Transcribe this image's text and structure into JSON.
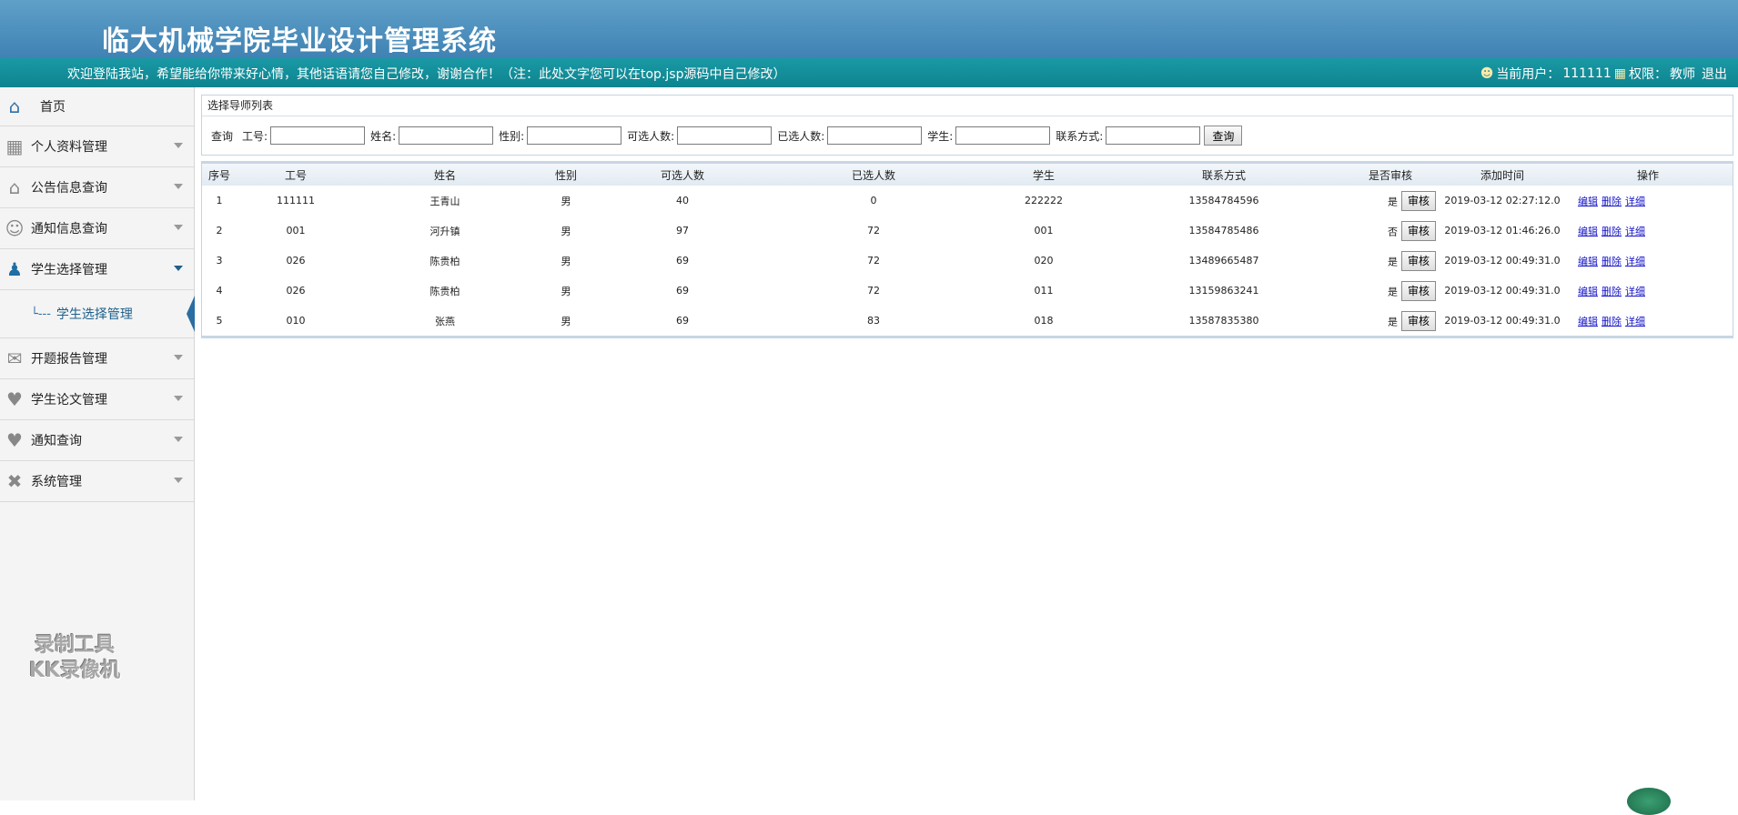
{
  "header": {
    "title": "临大机械学院毕业设计管理系统",
    "welcome": "欢迎登陆我站，希望能给你带来好心情，其他话语请您自己修改，谢谢合作！（注：此处文字您可以在top.jsp源码中自己修改）",
    "current_user_label": "当前用户：",
    "current_user": "111111",
    "role_label": "权限：",
    "role": "教师",
    "logout": "退出"
  },
  "sidebar": {
    "items": [
      {
        "label": "首页",
        "icon": "home-icon"
      },
      {
        "label": "个人资料管理",
        "icon": "grid-icon"
      },
      {
        "label": "公告信息查询",
        "icon": "house-icon"
      },
      {
        "label": "通知信息查询",
        "icon": "users-icon"
      },
      {
        "label": "学生选择管理",
        "icon": "user-icon"
      },
      {
        "label": "开题报告管理",
        "icon": "chat-icon"
      },
      {
        "label": "学生论文管理",
        "icon": "heart-icon"
      },
      {
        "label": "通知查询",
        "icon": "heart-icon"
      },
      {
        "label": "系统管理",
        "icon": "tools-icon"
      }
    ],
    "submenu_label": "学生选择管理",
    "watermark_line1": "录制工具",
    "watermark_line2": "KK录像机"
  },
  "panel": {
    "title": "选择导师列表",
    "query_label": "查询",
    "fields": {
      "gonghao": "工号:",
      "name": "姓名:",
      "gender": "性别:",
      "selectable": "可选人数:",
      "selected": "已选人数:",
      "student": "学生:",
      "contact": "联系方式:"
    },
    "query_button": "查询"
  },
  "table": {
    "headers": [
      "序号",
      "工号",
      "姓名",
      "性别",
      "可选人数",
      "已选人数",
      "学生",
      "联系方式",
      "是否审核",
      "添加时间",
      "操作"
    ],
    "review_button": "审核",
    "ops": {
      "edit": "编辑",
      "delete": "删除",
      "detail": "详细"
    },
    "rows": [
      {
        "no": "1",
        "gonghao": "111111",
        "name": "王青山",
        "gender": "男",
        "selectable": "40",
        "selected": "0",
        "student": "222222",
        "contact": "13584784596",
        "reviewed": "是",
        "time": "2019-03-12 02:27:12.0"
      },
      {
        "no": "2",
        "gonghao": "001",
        "name": "河升镇",
        "gender": "男",
        "selectable": "97",
        "selected": "72",
        "student": "001",
        "contact": "13584785486",
        "reviewed": "否",
        "time": "2019-03-12 01:46:26.0"
      },
      {
        "no": "3",
        "gonghao": "026",
        "name": "陈贵柏",
        "gender": "男",
        "selectable": "69",
        "selected": "72",
        "student": "020",
        "contact": "13489665487",
        "reviewed": "是",
        "time": "2019-03-12 00:49:31.0"
      },
      {
        "no": "4",
        "gonghao": "026",
        "name": "陈贵柏",
        "gender": "男",
        "selectable": "69",
        "selected": "72",
        "student": "011",
        "contact": "13159863241",
        "reviewed": "是",
        "time": "2019-03-12 00:49:31.0"
      },
      {
        "no": "5",
        "gonghao": "010",
        "name": "张燕",
        "gender": "男",
        "selectable": "69",
        "selected": "83",
        "student": "018",
        "contact": "13587835380",
        "reviewed": "是",
        "time": "2019-03-12 00:49:31.0"
      }
    ]
  }
}
